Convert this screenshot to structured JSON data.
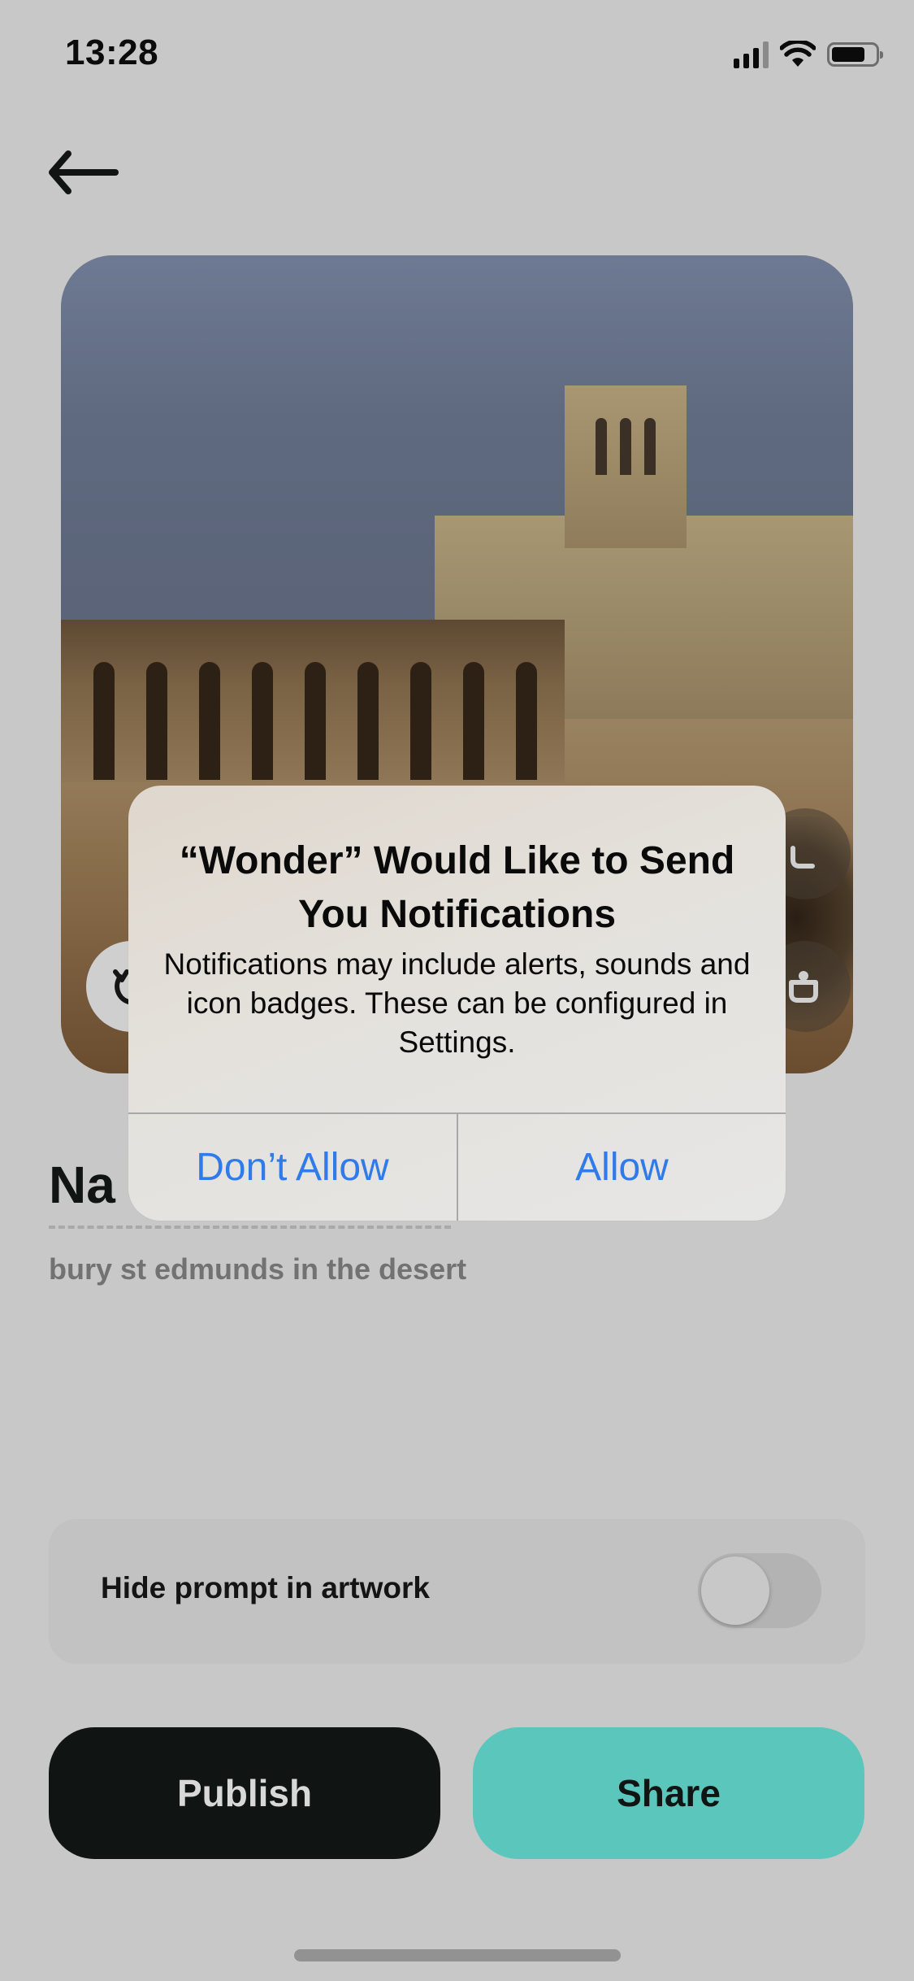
{
  "status_bar": {
    "time": "13:28",
    "signal_icon": "cellular-signal-icon",
    "wifi_icon": "wifi-icon",
    "battery_icon": "battery-icon"
  },
  "nav": {
    "back_icon": "arrow-left-icon"
  },
  "artwork": {
    "description": "AI-generated image of a cathedral with arcades in a desert",
    "left_button_icon": "regenerate-icon",
    "right_button_top_icon": "action-icon",
    "right_button_bottom_icon": "action-icon"
  },
  "details": {
    "title_visible": "Na",
    "prompt": "bury st edmunds in the desert"
  },
  "settings": {
    "hide_prompt_label": "Hide prompt in artwork",
    "hide_prompt_enabled": false
  },
  "actions": {
    "publish_label": "Publish",
    "share_label": "Share"
  },
  "alert": {
    "title": "“Wonder” Would Like to Send You Notifications",
    "message": "Notifications may include alerts, sounds and icon badges. These can be configured in Settings.",
    "dont_allow_label": "Don’t Allow",
    "allow_label": "Allow"
  },
  "colors": {
    "background": "#c8c8c8",
    "publish_bg": "#101413",
    "share_bg": "#5bc6bb",
    "alert_button_text": "#2f7bea"
  }
}
